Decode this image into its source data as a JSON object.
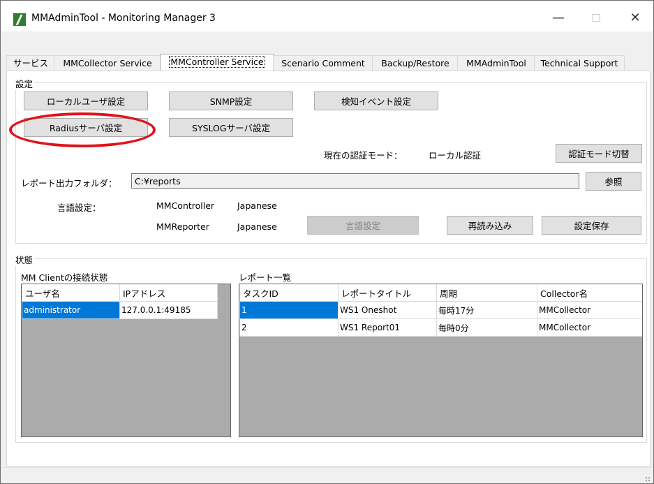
{
  "window": {
    "title": "MMAdminTool - Monitoring Manager 3"
  },
  "titlebar_buttons": {
    "minimize": "—",
    "maximize": "☐",
    "close": "✕"
  },
  "tabs": [
    {
      "label": "サービス"
    },
    {
      "label": "MMCollector Service"
    },
    {
      "label": "MMController Service"
    },
    {
      "label": "Scenario Comment"
    },
    {
      "label": "Backup/Restore"
    },
    {
      "label": "MMAdminTool"
    },
    {
      "label": "Technical Support"
    }
  ],
  "settings": {
    "group_label": "設定",
    "local_user_button": "ローカルユーザ設定",
    "snmp_button": "SNMP設定",
    "detect_event_button": "検知イベント設定",
    "radius_button": "Radiusサーバ設定",
    "syslog_button": "SYSLOGサーバ設定",
    "auth_mode_label": "現在の認証モード：",
    "auth_mode_value": "ローカル認証",
    "auth_mode_switch_button": "認証モード切替",
    "report_folder_label": "レポート出力フォルダ：",
    "report_folder_value": "C:¥reports",
    "browse_button": "参照",
    "language_label": "言語設定：",
    "mmcontroller_label": "MMController",
    "mmcontroller_lang": "Japanese",
    "mmreporter_label": "MMReporter",
    "mmreporter_lang": "Japanese",
    "language_button": "言語設定",
    "reload_button": "再読み込み",
    "save_button": "設定保存"
  },
  "status": {
    "group_label": "状態",
    "client_label": "MM Clientの接続状態",
    "client_headers": [
      "ユーザ名",
      "IPアドレス"
    ],
    "client_rows": [
      [
        "administrator",
        "127.0.0.1:49185"
      ]
    ],
    "report_label": "レポート一覧",
    "report_headers": [
      "タスクID",
      "レポートタイトル",
      "周期",
      "Collector名"
    ],
    "report_rows": [
      [
        "1",
        "WS1 Oneshot",
        "毎時17分",
        "MMCollector"
      ],
      [
        "2",
        "WS1 Report01",
        "毎時0分",
        "MMCollector"
      ]
    ]
  },
  "colors": {
    "selection": "#0078d7",
    "annotation": "#e0121b",
    "grid_bg": "#ababab"
  }
}
